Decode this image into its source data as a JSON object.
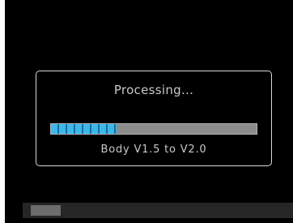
{
  "dialog": {
    "title": "Processing...",
    "progress_fraction": 0.32,
    "status": "Body V1.5 to V2.0"
  },
  "bottom_scroll": {
    "position_fraction": 0.03
  },
  "colors": {
    "background": "#000000",
    "progress_fill": "#3ab8ec",
    "progress_track": "#8c8c8c",
    "text": "#c8c8c8"
  }
}
